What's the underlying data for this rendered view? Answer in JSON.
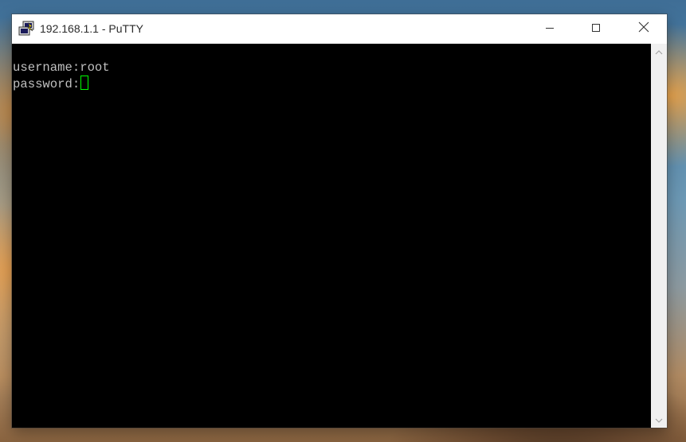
{
  "window": {
    "title": "192.168.1.1 - PuTTY",
    "app_icon": "putty-icon",
    "controls": {
      "minimize_icon": "minimize-icon",
      "maximize_icon": "maximize-icon",
      "close_icon": "close-icon"
    }
  },
  "terminal": {
    "lines": [
      "username:root",
      "password:"
    ],
    "cursor_color": "#00ff00",
    "text_color": "#c0c0c0",
    "background": "#000000"
  },
  "scrollbar": {
    "up_icon": "chevron-up-icon",
    "down_icon": "chevron-down-icon"
  }
}
